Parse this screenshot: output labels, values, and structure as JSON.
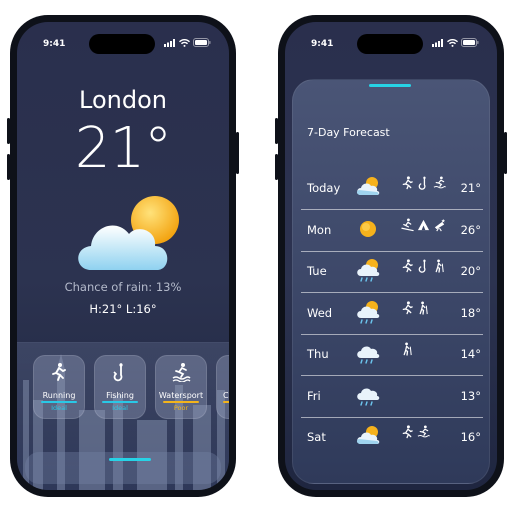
{
  "status_bar": {
    "time": "9:41"
  },
  "current": {
    "city": "London",
    "temperature": "21°",
    "chance_of_rain": "Chance of rain: 13%",
    "high_low": "H:21° L:16°",
    "condition_icon": "sun-behind-cloud-icon"
  },
  "activities": [
    {
      "name": "Running",
      "rating": "Ideal",
      "icon": "running-icon",
      "color": "#29c8e6"
    },
    {
      "name": "Fishing",
      "rating": "Ideal",
      "icon": "fishing-icon",
      "color": "#29c8e6"
    },
    {
      "name": "Watersport",
      "rating": "Poor",
      "icon": "watersport-icon",
      "color": "#f2b41c"
    },
    {
      "name": "C",
      "rating": "",
      "icon": "",
      "color": "#f2b41c"
    }
  ],
  "forecast": {
    "title": "7-Day Forecast",
    "days": [
      {
        "day": "Today",
        "temp": "21°",
        "condition": "sun-behind-cloud",
        "activities": [
          "running-icon",
          "fishing-icon",
          "watersport-icon"
        ]
      },
      {
        "day": "Mon",
        "temp": "26°",
        "condition": "sun",
        "activities": [
          "skiing-icon",
          "camping-icon",
          "stargazing-icon"
        ]
      },
      {
        "day": "Tue",
        "temp": "20°",
        "condition": "sun-behind-rain-cloud",
        "activities": [
          "running-icon",
          "fishing-icon",
          "hiking-icon"
        ]
      },
      {
        "day": "Wed",
        "temp": "18°",
        "condition": "sun-behind-rain-cloud",
        "activities": [
          "running-icon",
          "hiking-icon"
        ]
      },
      {
        "day": "Thu",
        "temp": "14°",
        "condition": "rain-cloud",
        "activities": [
          "hiking-icon"
        ]
      },
      {
        "day": "Fri",
        "temp": "13°",
        "condition": "rain-cloud",
        "activities": []
      },
      {
        "day": "Sat",
        "temp": "16°",
        "condition": "sun-behind-cloud",
        "activities": [
          "running-icon",
          "watersport-icon"
        ]
      }
    ]
  },
  "colors": {
    "accent": "#27d3e6",
    "ideal": "#29c8e6",
    "poor": "#f2b41c",
    "sun": "#f6b21c"
  }
}
